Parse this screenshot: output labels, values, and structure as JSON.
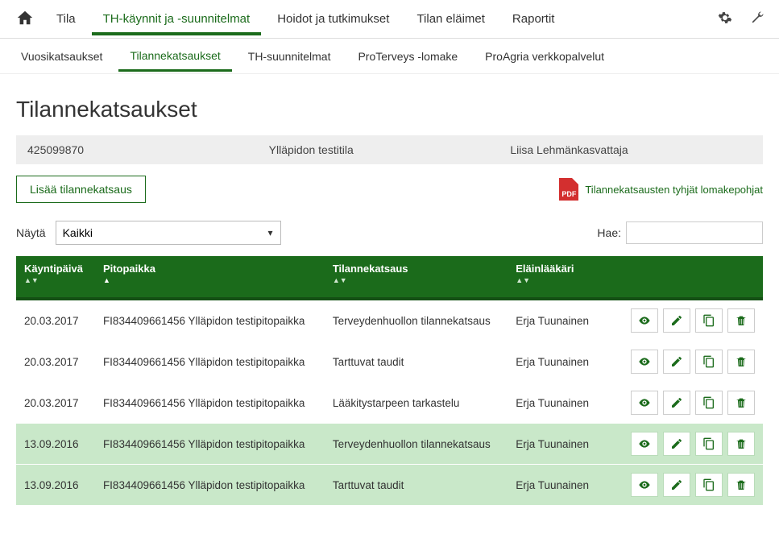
{
  "topnav": {
    "items": [
      "Tila",
      "TH-käynnit ja -suunnitelmat",
      "Hoidot ja tutkimukset",
      "Tilan eläimet",
      "Raportit"
    ],
    "active_index": 1
  },
  "subnav": {
    "items": [
      "Vuosikatsaukset",
      "Tilannekatsaukset",
      "TH-suunnitelmat",
      "ProTerveys -lomake",
      "ProAgria verkkopalvelut"
    ],
    "active_index": 1
  },
  "page_title": "Tilannekatsaukset",
  "farm": {
    "id": "425099870",
    "name": "Ylläpidon testitila",
    "person": "Liisa Lehmänkasvattaja"
  },
  "buttons": {
    "add_review": "Lisää tilannekatsaus",
    "pdf_link": "Tilannekatsausten tyhjät lomakepohjat",
    "pdf_badge": "PDF"
  },
  "filter": {
    "show_label": "Näytä",
    "show_value": "Kaikki",
    "search_label": "Hae:",
    "search_value": ""
  },
  "table": {
    "columns": [
      "Käyntipäivä",
      "Pitopaikka",
      "Tilannekatsaus",
      "Eläinlääkäri"
    ],
    "rows": [
      {
        "date": "20.03.2017",
        "place": "FI834409661456 Ylläpidon testipitopaikka",
        "review": "Terveydenhuollon tilannekatsaus",
        "vet": "Erja Tuunainen",
        "alt": false
      },
      {
        "date": "20.03.2017",
        "place": "FI834409661456 Ylläpidon testipitopaikka",
        "review": "Tarttuvat taudit",
        "vet": "Erja Tuunainen",
        "alt": false
      },
      {
        "date": "20.03.2017",
        "place": "FI834409661456 Ylläpidon testipitopaikka",
        "review": "Lääkitystarpeen tarkastelu",
        "vet": "Erja Tuunainen",
        "alt": false
      },
      {
        "date": "13.09.2016",
        "place": "FI834409661456 Ylläpidon testipitopaikka",
        "review": "Terveydenhuollon tilannekatsaus",
        "vet": "Erja Tuunainen",
        "alt": true
      },
      {
        "date": "13.09.2016",
        "place": "FI834409661456 Ylläpidon testipitopaikka",
        "review": "Tarttuvat taudit",
        "vet": "Erja Tuunainen",
        "alt": true
      }
    ]
  },
  "icons": {
    "view": "eye-icon",
    "edit": "pencil-icon",
    "copy": "copy-icon",
    "delete": "trash-icon"
  }
}
